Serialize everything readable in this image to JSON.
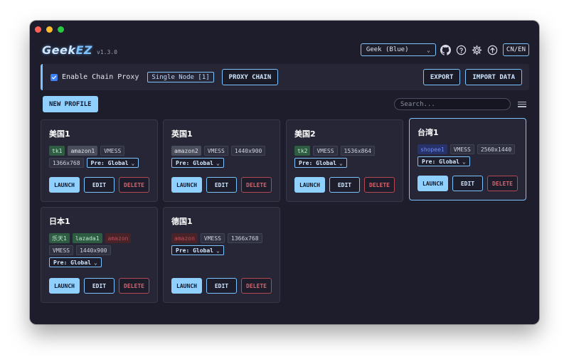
{
  "app": {
    "logo_main": "Geek",
    "logo_accent": "EZ",
    "version": "v1.3.0",
    "theme_selected": "Geek (Blue)",
    "lang_label": "CN/EN"
  },
  "icons": {
    "github": "github-icon",
    "help": "help-circle-icon",
    "settings": "gear-icon",
    "update": "arrow-up-circle-icon",
    "menu": "list-icon",
    "chevron": "chevron-down-icon",
    "check": "check-icon"
  },
  "colors": {
    "accent": "#7cc4ff",
    "launch_fill": "#8fd0ff",
    "danger": "#d9626b",
    "background": "#1d1d2b",
    "card": "#262636"
  },
  "proxy": {
    "enabled": true,
    "label": "Enable Chain Proxy",
    "mode": "Single Node [1]",
    "chain_button": "PROXY CHAIN",
    "export_button": "EXPORT",
    "import_button": "IMPORT DATA"
  },
  "toolbar": {
    "new_profile": "NEW PROFILE",
    "search_placeholder": "Search..."
  },
  "buttons": {
    "launch": "LAUNCH",
    "edit": "EDIT",
    "delete": "DELETE"
  },
  "profiles": [
    {
      "name": "美国1",
      "selected": false,
      "tags": [
        {
          "text": "tk1",
          "style": "green"
        },
        {
          "text": "amazon1",
          "style": "gray"
        },
        {
          "text": "VMESS",
          "style": "plain"
        },
        {
          "text": "1366x768",
          "style": "plain"
        }
      ],
      "pre": "Pre: Global"
    },
    {
      "name": "英国1",
      "selected": false,
      "tags": [
        {
          "text": "amazon2",
          "style": "gray"
        },
        {
          "text": "VMESS",
          "style": "plain"
        },
        {
          "text": "1440x900",
          "style": "plain"
        }
      ],
      "pre": "Pre: Global"
    },
    {
      "name": "美国2",
      "selected": false,
      "tags": [
        {
          "text": "tk2",
          "style": "green"
        },
        {
          "text": "VMESS",
          "style": "plain"
        },
        {
          "text": "1536x864",
          "style": "plain"
        }
      ],
      "pre": "Pre: Global"
    },
    {
      "name": "台湾1",
      "selected": true,
      "tags": [
        {
          "text": "shopee1",
          "style": "blue"
        },
        {
          "text": "VMESS",
          "style": "plain"
        },
        {
          "text": "2560x1440",
          "style": "plain"
        }
      ],
      "pre": "Pre: Global"
    },
    {
      "name": "日本1",
      "selected": false,
      "tags": [
        {
          "text": "乐天1",
          "style": "green"
        },
        {
          "text": "lazada1",
          "style": "green"
        },
        {
          "text": "amazon",
          "style": "red"
        },
        {
          "text": "VMESS",
          "style": "plain"
        },
        {
          "text": "1440x900",
          "style": "plain"
        }
      ],
      "pre": "Pre: Global"
    },
    {
      "name": "德国1",
      "selected": false,
      "tags": [
        {
          "text": "amazon",
          "style": "red"
        },
        {
          "text": "VMESS",
          "style": "plain"
        },
        {
          "text": "1366x768",
          "style": "plain"
        }
      ],
      "pre": "Pre: Global"
    }
  ]
}
